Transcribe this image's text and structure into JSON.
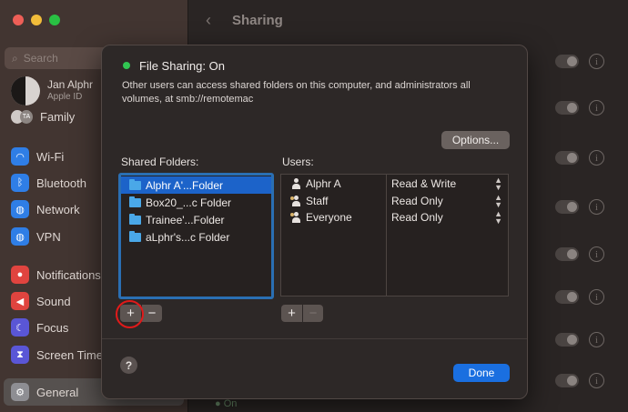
{
  "colors": {
    "accent": "#1a6fe0",
    "status_on": "#31c552",
    "highlight": "#e01a1a"
  },
  "sidebar": {
    "search_placeholder": "Search",
    "account": {
      "name": "Jan Alphr",
      "subtitle": "Apple ID"
    },
    "family": {
      "label": "Family",
      "initials": "TA"
    },
    "items": [
      {
        "label": "Wi-Fi",
        "icon": "wifi-icon",
        "color": "#2f7ee6"
      },
      {
        "label": "Bluetooth",
        "icon": "bluetooth-icon",
        "color": "#2f7ee6"
      },
      {
        "label": "Network",
        "icon": "globe-icon",
        "color": "#2f7ee6"
      },
      {
        "label": "VPN",
        "icon": "globe-icon",
        "color": "#2f7ee6"
      },
      {
        "label": "Notifications",
        "icon": "bell-icon",
        "color": "#e0443f"
      },
      {
        "label": "Sound",
        "icon": "speaker-icon",
        "color": "#e0443f"
      },
      {
        "label": "Focus",
        "icon": "moon-icon",
        "color": "#5a56d6"
      },
      {
        "label": "Screen Time",
        "icon": "hourglass-icon",
        "color": "#5a56d6"
      },
      {
        "label": "General",
        "icon": "gear-icon",
        "color": "#8e8e93"
      }
    ]
  },
  "main": {
    "title": "Sharing",
    "back_glyph": "‹",
    "bottom_status": "On"
  },
  "dialog": {
    "title": "File Sharing: On",
    "description": "Other users can access shared folders on this computer, and administrators all volumes, at smb://remotemac",
    "options_label": "Options...",
    "shared_folders_label": "Shared Folders:",
    "users_label": "Users:",
    "folders": [
      {
        "name": "Alphr A'...Folder",
        "selected": true
      },
      {
        "name": "Box20_...c Folder",
        "selected": false
      },
      {
        "name": "Trainee'...Folder",
        "selected": false
      },
      {
        "name": "aLphr's...c Folder",
        "selected": false
      }
    ],
    "users": [
      {
        "name": "Alphr A",
        "permission": "Read & Write",
        "icon": "person-icon"
      },
      {
        "name": "Staff",
        "permission": "Read Only",
        "icon": "group-icon"
      },
      {
        "name": "Everyone",
        "permission": "Read Only",
        "icon": "group-icon"
      }
    ],
    "add_label": "+",
    "remove_label": "−",
    "help_label": "?",
    "done_label": "Done"
  }
}
